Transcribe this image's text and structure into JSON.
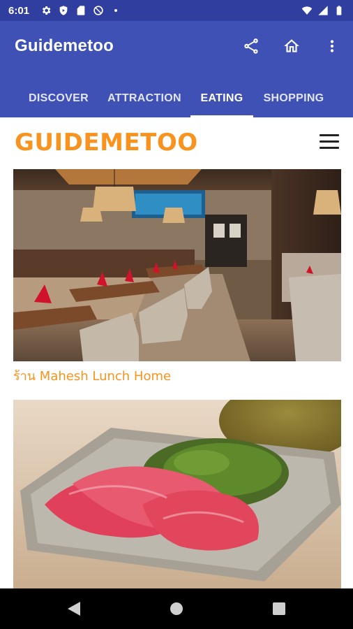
{
  "status_bar": {
    "time": "6:01",
    "left_icons": [
      "gear-icon",
      "shield-icon",
      "sd-card-icon",
      "no-disturb-icon",
      "dot-icon"
    ],
    "right_icons": [
      "wifi-icon",
      "signal-icon",
      "battery-icon"
    ]
  },
  "app_bar": {
    "title": "Guidemetoo",
    "actions": [
      "share-icon",
      "home-icon",
      "more-vert-icon"
    ]
  },
  "tabs": {
    "items": [
      {
        "label": "DISCOVER"
      },
      {
        "label": "ATTRACTION"
      },
      {
        "label": "EATING"
      },
      {
        "label": "SHOPPING"
      }
    ],
    "active": "EATING"
  },
  "brand": {
    "logo_text": "GUIDEMETOO",
    "menu_icon": "hamburger-icon"
  },
  "cards": [
    {
      "title": "ร้าน Mahesh Lunch Home",
      "image": "restaurant interior photo"
    },
    {
      "title": "",
      "image": "sliced marbled beef with green garnish photo"
    }
  ],
  "nav_bar": {
    "buttons": [
      "back-icon",
      "home-circle-icon",
      "recents-icon"
    ]
  },
  "colors": {
    "status_bar": "#303f9f",
    "app_bar": "#3f51b5",
    "brand_orange": "#f7931e",
    "nav_bar": "#000000"
  }
}
